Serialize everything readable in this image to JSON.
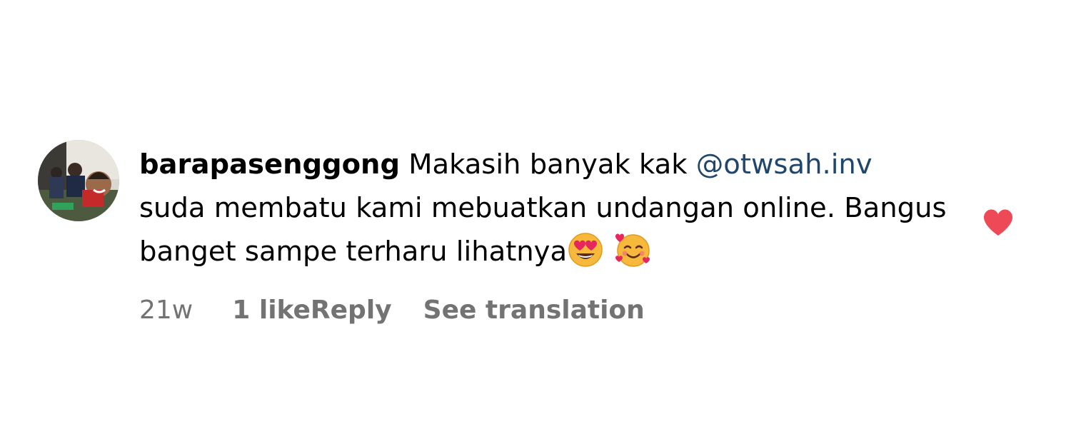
{
  "comment": {
    "username": "barapasenggong",
    "text_part1": "Makasih banyak kak ",
    "mention": "@otwsah.inv",
    "text_part2": "suda membatu kami mebuatkan undangan online. Bangus banget sampe terharu lihatnya",
    "emojis": [
      "smiling-face-with-heart-eyes-icon",
      "smiling-face-with-hearts-icon"
    ],
    "meta": {
      "time": "21w",
      "likes": "1 like",
      "reply": "Reply",
      "translation": "See translation"
    },
    "like_state": "liked",
    "like_color": "#ed4956"
  },
  "colors": {
    "mention": "#21466b",
    "meta": "#737373",
    "text": "#000000"
  }
}
